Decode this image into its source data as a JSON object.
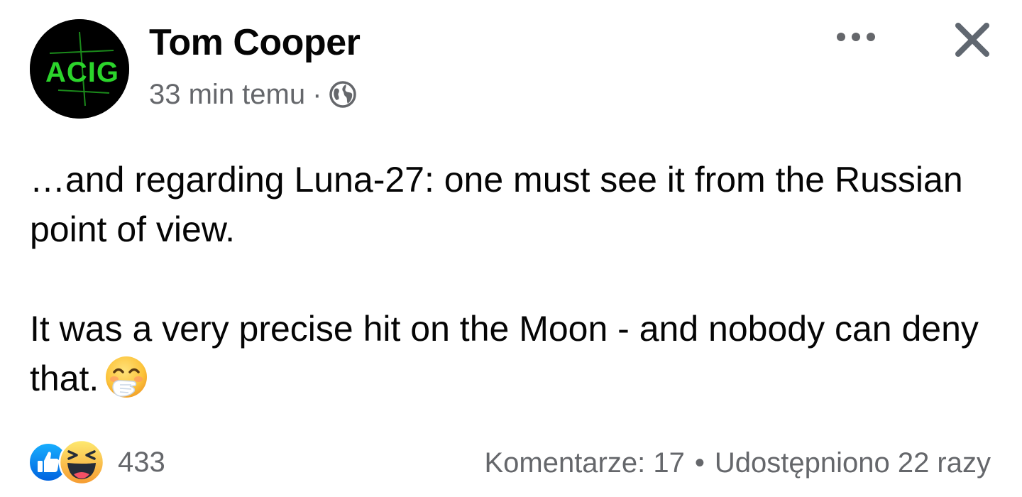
{
  "post": {
    "author": "Tom Cooper",
    "avatar_text": "ACIG",
    "timestamp": "33 min temu",
    "meta_separator": "·",
    "audience_icon": "globe-icon",
    "body_paragraphs": [
      "…and regarding Luna-27: one must see it from the Russian point of view.",
      "It was a very precise hit on the Moon - and nobody can deny that."
    ],
    "body_emoji": "face-with-hand-over-mouth-emoji",
    "header_actions": [
      "more-options-icon",
      "close-icon"
    ]
  },
  "footer": {
    "reactions": [
      "like-reaction-icon",
      "haha-reaction-icon"
    ],
    "reaction_count": "433",
    "comments": "Komentarze: 17",
    "separator": "•",
    "shares": "Udostępniono 22 razy"
  },
  "colors": {
    "primary_text": "#050505",
    "secondary_text": "#65676b",
    "like_blue": "#1877f2",
    "haha_yellow": "#f7b125",
    "avatar_green": "#2bd42b"
  }
}
